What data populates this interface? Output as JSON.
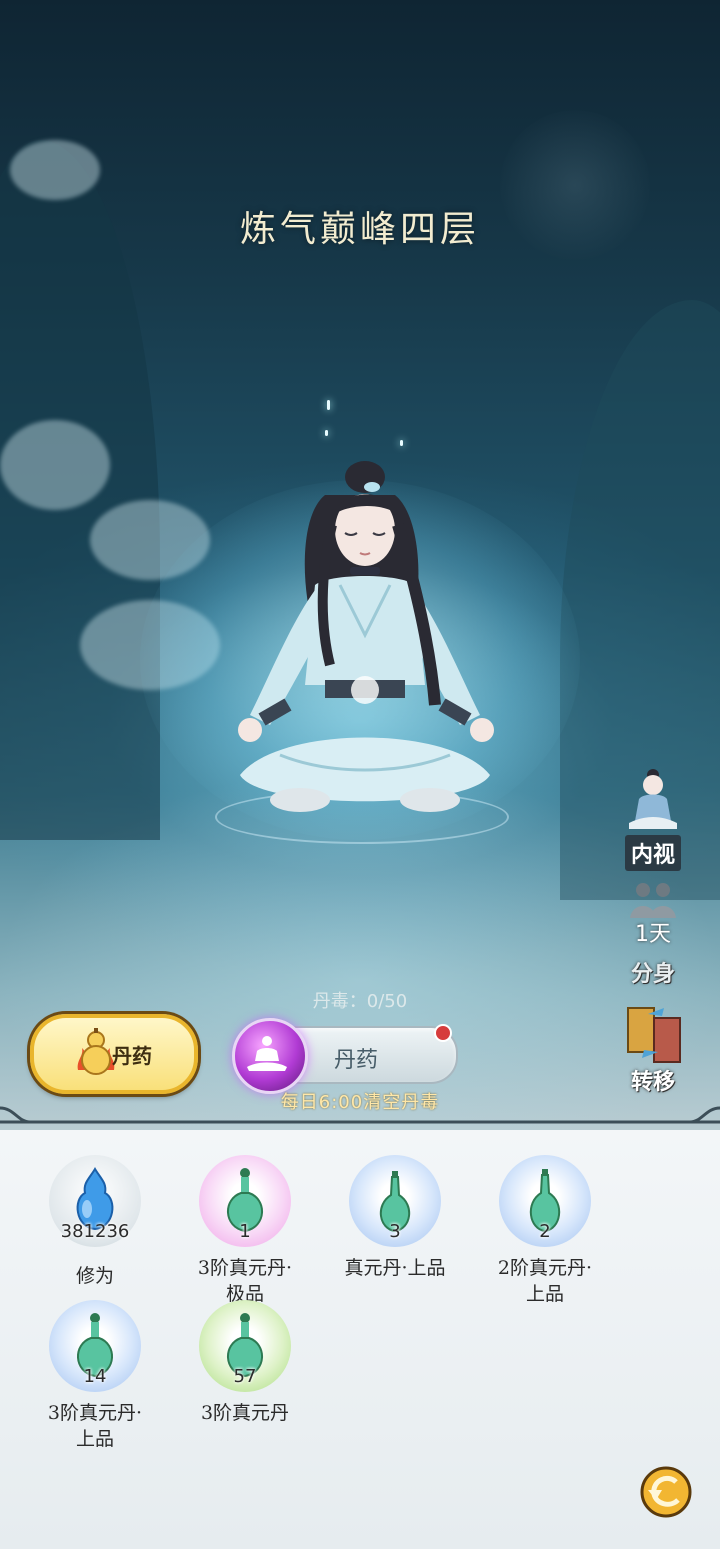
{
  "realm_title": "炼气巅峰四层",
  "side_buttons": [
    {
      "label": "内视"
    },
    {
      "label": "分身",
      "timer": "1天"
    },
    {
      "label": "转移"
    }
  ],
  "pill_button": {
    "label": "丹药"
  },
  "poison": {
    "label": "丹毒",
    "text": "丹毒：0/50",
    "current": 0,
    "max": 50
  },
  "select_bar": {
    "label": "丹药"
  },
  "clear_tip": "每日6:00清空丹毒",
  "items": [
    {
      "count": "381236",
      "name": "修为",
      "name2": "",
      "bubble": "white",
      "icon": "blue-gourd-icon"
    },
    {
      "count": "1",
      "name": "3阶真元丹·",
      "name2": "极品",
      "bubble": "pink",
      "icon": "elixir-bottle-icon"
    },
    {
      "count": "3",
      "name": "真元丹·上品",
      "name2": "",
      "bubble": "blue",
      "icon": "elixir-bottle-icon"
    },
    {
      "count": "2",
      "name": "2阶真元丹·",
      "name2": "上品",
      "bubble": "blue",
      "icon": "elixir-bottle-icon"
    },
    {
      "count": "14",
      "name": "3阶真元丹·",
      "name2": "上品",
      "bubble": "blue",
      "icon": "elixir-bottle-icon"
    },
    {
      "count": "57",
      "name": "3阶真元丹",
      "name2": "",
      "bubble": "green",
      "icon": "elixir-bottle-icon"
    }
  ],
  "colors": {
    "accent_gold": "#f9e07a",
    "orb_purple": "#b13bd4",
    "badge_red": "#d63c3c"
  }
}
